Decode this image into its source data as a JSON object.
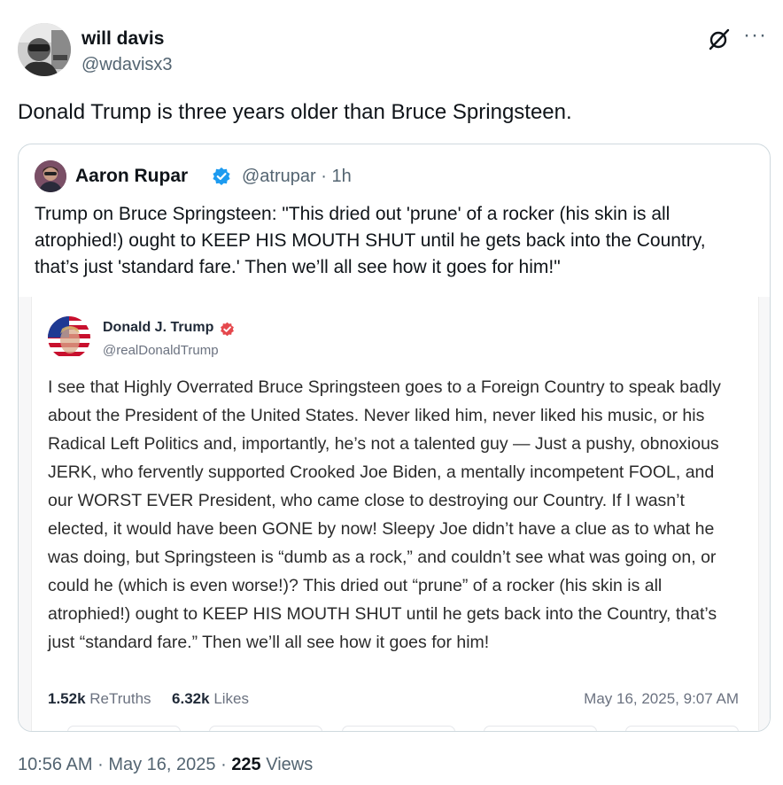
{
  "tweet": {
    "author_name": "will davis",
    "author_handle": "@wdavisx3",
    "text": "Donald Trump is three years older than Bruce Springsteen.",
    "time": "10:56 AM",
    "date": "May 16, 2025",
    "views_count": "225",
    "views_label": "Views",
    "separator": "·"
  },
  "quoted": {
    "author_name": "Aaron Rupar",
    "author_handle": "@atrupar",
    "age": "1h",
    "separator": "·",
    "text": "Trump on Bruce Springsteen: \"This dried out 'prune' of a rocker (his skin is all atrophied!) ought to KEEP HIS MOUTH SHUT until he gets back into the Country, that’s just 'standard fare.' Then we’ll all see how it goes for him!\""
  },
  "truth": {
    "author_name": "Donald J. Trump",
    "author_handle": "@realDonaldTrump",
    "body": "I see that Highly Overrated Bruce Springsteen goes to a Foreign Country to speak badly about the President of the United States. Never liked him, never liked his music, or his Radical Left Politics and, importantly, he’s not a talented guy — Just a pushy, obnoxious JERK, who fervently supported Crooked Joe Biden, a mentally incompetent FOOL, and our WORST EVER President, who came close to destroying our Country. If I wasn’t elected, it would have been GONE by now! Sleepy Joe didn’t have a clue as to what he was doing, but Springsteen is “dumb as a rock,” and couldn’t see what was going on, or could he (which is even worse!)? This dried out “prune” of a rocker (his skin is all atrophied!) ought to KEEP HIS MOUTH SHUT until he gets back into the Country, that’s just “standard fare.” Then we’ll all see how it goes for him!",
    "retruths_count": "1.52k",
    "retruths_label": "ReTruths",
    "likes_count": "6.32k",
    "likes_label": "Likes",
    "timestamp": "May 16, 2025, 9:07 AM"
  },
  "icons": {
    "grok": "grok-icon",
    "more": "more-icon",
    "verified": "verified-badge-icon",
    "truth_verified": "truth-verified-badge-icon"
  },
  "colors": {
    "text_primary": "#0f1419",
    "text_secondary": "#536471",
    "border": "#cfd9de",
    "x_verified": "#1d9bf0",
    "truth_verified": "#e5484d"
  }
}
